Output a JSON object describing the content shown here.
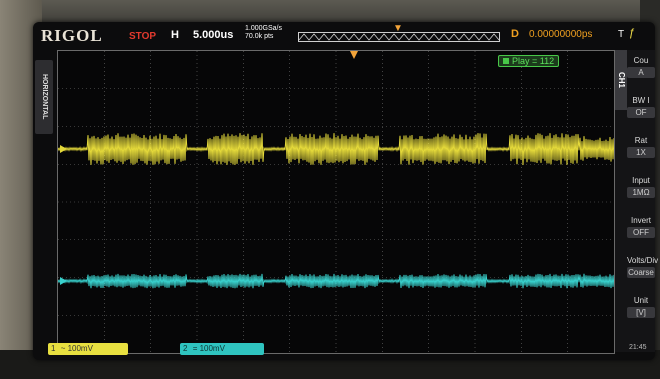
{
  "status_bar": {
    "brand": "RIGOL",
    "run_state": "STOP",
    "h_label": "H",
    "timebase": "5.000us",
    "sample_rate": "1.000GSa/s",
    "points": "70.0k pts",
    "delay_label": "D",
    "delay_value": "0.00000000ps",
    "trigger_label": "T"
  },
  "side_tab": {
    "label": "HORIZONTAL"
  },
  "play_counter": {
    "label": "Play = 112"
  },
  "menu": {
    "channel": "CH1",
    "items": [
      {
        "label": "Cou",
        "value": "A"
      },
      {
        "label": "BW I",
        "value": "OF"
      },
      {
        "label": "Rat",
        "value": "1X"
      },
      {
        "label": "Input",
        "value": "1MΩ"
      },
      {
        "label": "Invert",
        "value": "OFF"
      },
      {
        "label": "Volts/Div",
        "value": "Coarse"
      },
      {
        "label": "Unit",
        "value": "[V]"
      }
    ],
    "clock": "21:45"
  },
  "channels": {
    "ch1": {
      "index": "1",
      "scale": "~ 100mV",
      "color": "#e8e040"
    },
    "ch2": {
      "index": "2",
      "scale": "= 100mV",
      "color": "#2fc4c0"
    }
  },
  "colors": {
    "ch1_trace": "#e3d83a",
    "ch2_trace": "#39d1cd",
    "grid": "#6a6a6a"
  }
}
